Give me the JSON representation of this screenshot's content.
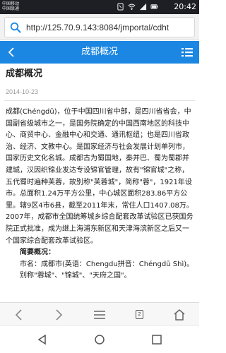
{
  "status_bar": {
    "carrier_line1": "中国移动",
    "carrier_line2": "中国联通",
    "time": "20:42",
    "icons": [
      "nfc-icon",
      "wifi-icon",
      "signal-icon",
      "battery-icon"
    ]
  },
  "url_bar": {
    "url": "http://125.70.9.143:8084/jmportal/cdht",
    "icon": "search-icon"
  },
  "app_header": {
    "title": "成都概况",
    "back_icon": "chevron-left-icon",
    "menu_icon": "list-menu-icon",
    "color": "#1c87e2"
  },
  "article": {
    "title": "成都概况",
    "date": "2014-10-23",
    "paragraphs": [
      "成都(Chéngdū)，位于中国四川省中部，是四川省省会，中国副省级城市之一，是国务院确定的中国西南地区的科技中心、商贸中心、金融中心和交通、通讯枢纽；也是四川省政治、经济、文教中心。是国家经济与社会发展计划单列市，国家历史文化名城。成都古为蜀国地，秦并巴、蜀为蜀郡并建城，汉因织锦业发达专设锦官管理，故有\"锦官城\"之称，五代蜀时遍种芙蓉，故别称\"芙蓉城\"，简称\"蓉\"，1921年设市。总面积1.24万平方公里，中心城区面积283.86平方公里。辖9区4市6县，截至2011年末，常住人口1407.08万。2007年，成都市全国统筹城乡综合配套改革试验区已获国务院正式批准，成为继上海浦东新区和天津海滨新区之后又一个国家综合配套改革试验区。"
    ],
    "subheading": "简要概况：",
    "summary": "市名：成都市(英语：Chengdu拼音：Chéngdū Shì)。别称\"蓉城\"、\"锦城\"、\"天府之国\"。"
  },
  "toolbar": {
    "tab_count": "2",
    "icons": [
      "back-arrow-icon",
      "forward-arrow-icon",
      "hamburger-menu-icon",
      "tabs-icon",
      "home-icon"
    ]
  },
  "nav_bar": {
    "icons": [
      "nav-back-icon",
      "nav-home-icon",
      "nav-recent-icon"
    ]
  }
}
